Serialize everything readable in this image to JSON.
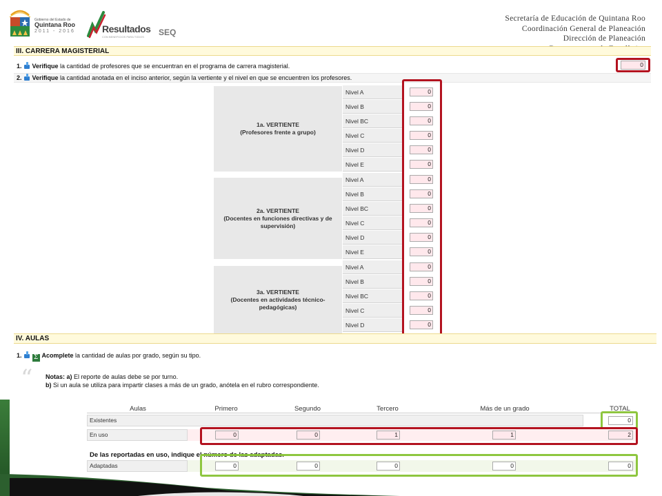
{
  "header": {
    "logo_qroo": {
      "line1": "Gobierno del Estado de",
      "line2": "Quintana Roo",
      "line3": "2011 - 2016"
    },
    "logo_resultados": {
      "word": "Resultados",
      "tagline": "CON BENEFICIOS PARA TODOS"
    },
    "logo_seq": "SEQ",
    "dept_lines": [
      "Secretaría de Educación de Quintana Roo",
      "Coordinación General de Planeación",
      "Dirección de Planeación",
      "Departamento de Estadística"
    ]
  },
  "section3": {
    "title": "III. CARRERA MAGISTERIAL",
    "q1": {
      "num": "1.",
      "verb": "Verifique",
      "text": " la cantidad de profesores que se encuentran en el programa de carrera magisterial.",
      "value": "0"
    },
    "q2": {
      "num": "2.",
      "verb": "Verifique",
      "text": " la cantidad anotada en el inciso anterior, según la vertiente y el nivel en que se encuentren los profesores."
    },
    "vertientes": [
      {
        "title": "1a. VERTIENTE",
        "subtitle": "(Profesores frente a grupo)",
        "niveles": [
          {
            "label": "Nivel A",
            "value": "0"
          },
          {
            "label": "Nivel B",
            "value": "0"
          },
          {
            "label": "Nivel BC",
            "value": "0"
          },
          {
            "label": "Nivel C",
            "value": "0"
          },
          {
            "label": "Nivel D",
            "value": "0"
          },
          {
            "label": "Nivel E",
            "value": "0"
          }
        ]
      },
      {
        "title": "2a. VERTIENTE",
        "subtitle": "(Docentes en funciones directivas y de supervisión)",
        "niveles": [
          {
            "label": "Nivel A",
            "value": "0"
          },
          {
            "label": "Nivel B",
            "value": "0"
          },
          {
            "label": "Nivel BC",
            "value": "0"
          },
          {
            "label": "Nivel C",
            "value": "0"
          },
          {
            "label": "Nivel D",
            "value": "0"
          },
          {
            "label": "Nivel E",
            "value": "0"
          }
        ]
      },
      {
        "title": "3a. VERTIENTE",
        "subtitle": "(Docentes en actividades técnico-pedagógicas)",
        "niveles": [
          {
            "label": "Nivel A",
            "value": "0"
          },
          {
            "label": "Nivel B",
            "value": "0"
          },
          {
            "label": "Nivel BC",
            "value": "0"
          },
          {
            "label": "Nivel C",
            "value": "0"
          },
          {
            "label": "Nivel D",
            "value": "0"
          }
        ]
      }
    ]
  },
  "section4": {
    "title": "IV. AULAS",
    "q1": {
      "num": "1.",
      "verb": "Acomplete",
      "text": " la cantidad de aulas por grado, según su tipo."
    },
    "notes": {
      "label": "Notas:",
      "a_key": "a)",
      "a_text": " El reporte de aulas debe se por turno.",
      "b_key": "b)",
      "b_text": " Si un aula se utiliza para impartir clases a más de un grado, anótela en el rubro correspondiente."
    },
    "columns": [
      "Aulas",
      "Primero",
      "Segundo",
      "Tercero",
      "Más de un grado",
      "TOTAL"
    ],
    "rows": {
      "existentes": {
        "label": "Existentes",
        "total": "0"
      },
      "en_uso": {
        "label": "En uso",
        "values": [
          "0",
          "0",
          "1",
          "1"
        ],
        "total": "2"
      },
      "adaptadas": {
        "label": "Adaptadas",
        "values": [
          "0",
          "0",
          "0",
          "0"
        ],
        "total": "0"
      }
    },
    "subheading": "De las reportadas en uso, indique el número de las adaptadas."
  },
  "colors": {
    "highlight_red": "#b3121f",
    "highlight_green": "#8ec63f",
    "section_bar": "#fffadc"
  }
}
